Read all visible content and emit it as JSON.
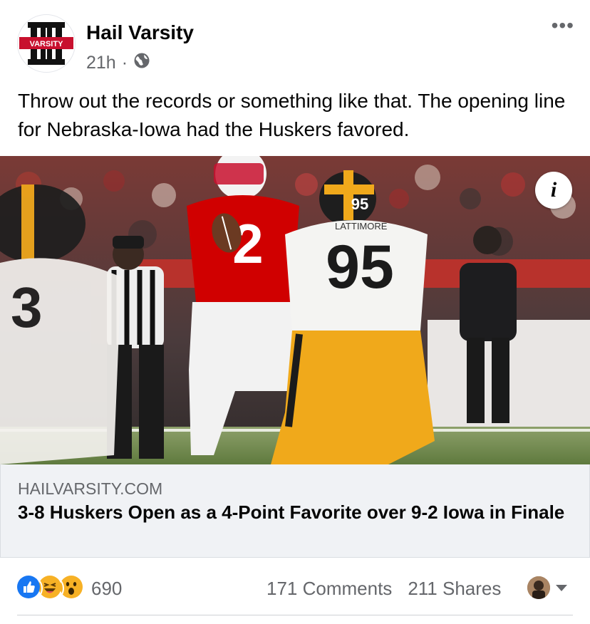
{
  "post": {
    "page_name": "Hail Varsity",
    "avatar_text": "VARSITY",
    "timestamp": "21h",
    "separator": "·",
    "privacy_icon": "globe-icon",
    "more_label": "•••",
    "caption": "Throw out the records or something like that. The opening line for Nebraska-Iowa had the Huskers favored."
  },
  "photo": {
    "info_label": "i",
    "jersey_qb": "2",
    "jersey_defender": "95",
    "helmet_number": "95",
    "nameplate": "LATTIMORE"
  },
  "link": {
    "domain": "HAILVARSITY.COM",
    "title": "3-8 Huskers Open as a 4-Point Favorite over 9-2 Iowa in Finale"
  },
  "footer": {
    "reactions": [
      "like-icon",
      "haha-icon",
      "wow-icon"
    ],
    "reaction_count": "690",
    "comments": "171 Comments",
    "shares": "211 Shares"
  },
  "colors": {
    "text": "#050505",
    "secondary": "#65676b",
    "like_blue": "#1877f2",
    "link_bg": "#f0f2f5",
    "nebraska_red": "#d00000",
    "iowa_gold": "#f0a91b"
  }
}
